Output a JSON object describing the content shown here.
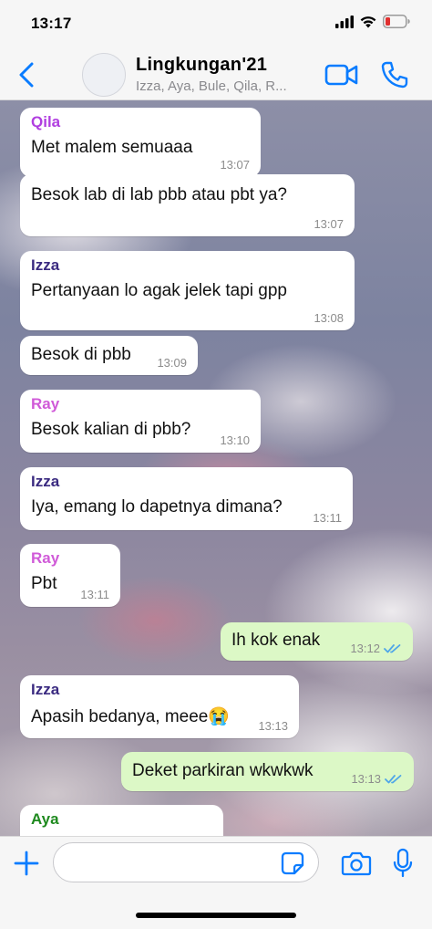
{
  "status_bar": {
    "time": "13:17"
  },
  "header": {
    "title": "Lingkungan'21",
    "subtitle": "Izza, Aya, Bule, Qila, R..."
  },
  "colors": {
    "accent": "#0a7cff",
    "incoming_bubble": "#ffffff",
    "outgoing_bubble": "#dcf8c6",
    "sender_qila": "#b03ee0",
    "sender_izza": "#3a2a80",
    "sender_ray": "#d05ad8",
    "sender_aya": "#1f8a1f",
    "read_ticks": "#4fa6e8"
  },
  "messages": [
    {
      "sender": "Qila",
      "text": "Met malem semuaaa",
      "time": "13:07"
    },
    {
      "sender": "",
      "text": "Besok lab di lab pbb atau pbt ya?",
      "time": "13:07"
    },
    {
      "sender": "Izza",
      "text": "Pertanyaan lo agak jelek tapi gpp",
      "time": "13:08"
    },
    {
      "sender": "",
      "text": "Besok di pbb",
      "time": "13:09"
    },
    {
      "sender": "Ray",
      "text": "Besok kalian di pbb?",
      "time": "13:10"
    },
    {
      "sender": "Izza",
      "text": "Iya, emang lo dapetnya dimana?",
      "time": "13:11"
    },
    {
      "sender": "Ray",
      "text": "Pbt",
      "time": "13:11"
    },
    {
      "sender": "",
      "text": "Ih kok enak",
      "time": "13:12",
      "status": "read"
    },
    {
      "sender": "Izza",
      "text": "Apasih bedanya, meee😭",
      "time": "13:13"
    },
    {
      "sender": "",
      "text": "Deket parkiran wkwkwk",
      "time": "13:13",
      "status": "read"
    },
    {
      "sender": "Aya",
      "text": "",
      "time": ""
    }
  ],
  "input": {
    "value": "",
    "placeholder": ""
  }
}
